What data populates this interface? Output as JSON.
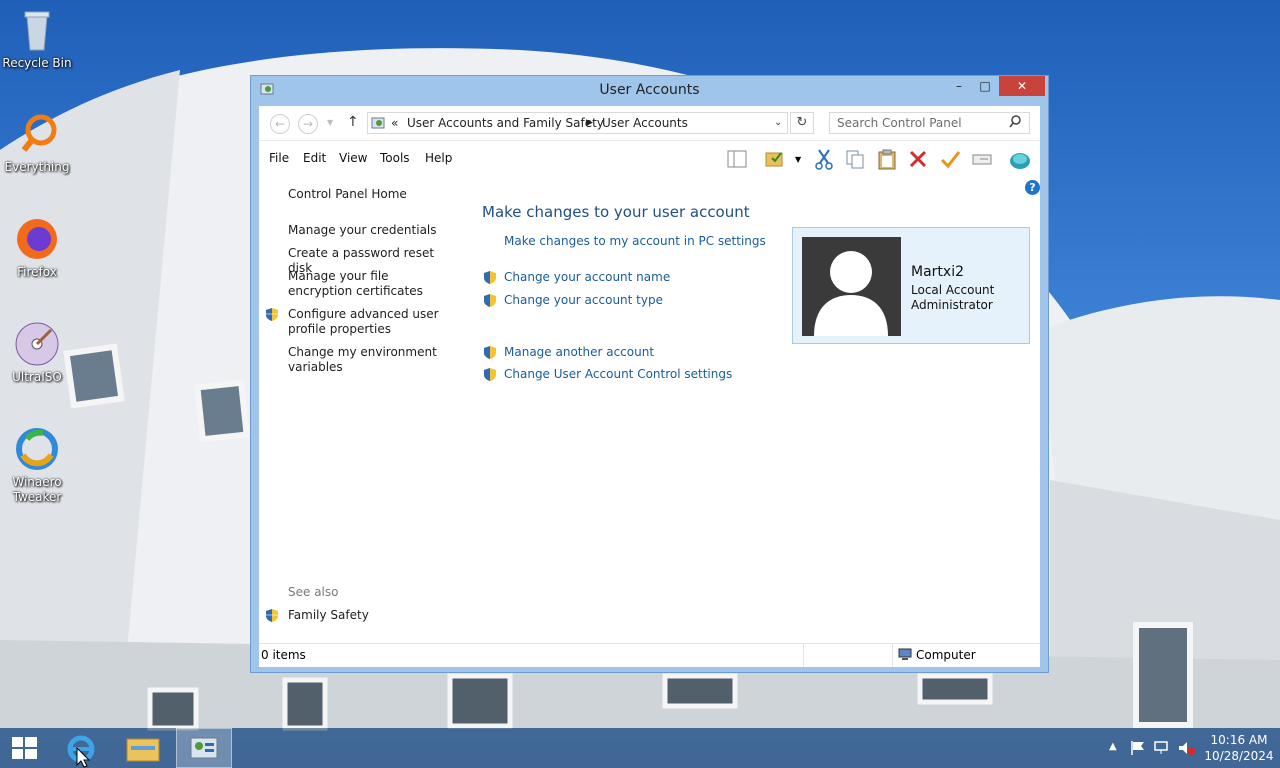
{
  "desktop_icons": [
    {
      "label": "Recycle Bin",
      "icon": "recycle-bin-icon"
    },
    {
      "label": "Everything",
      "icon": "everything-icon"
    },
    {
      "label": "Firefox",
      "icon": "firefox-icon"
    },
    {
      "label": "UltraISO",
      "icon": "ultraiso-icon"
    },
    {
      "label": "Winaero Tweaker",
      "icon": "winaero-tweaker-icon"
    }
  ],
  "window": {
    "title": "User Accounts",
    "controls": {
      "minimize": "–",
      "maximize": "□",
      "close": "✕"
    },
    "address": {
      "prefix": "«",
      "crumbs": [
        "User Accounts and Family Safety",
        "User Accounts"
      ]
    },
    "search": {
      "placeholder": "Search Control Panel"
    },
    "menu": [
      "File",
      "Edit",
      "View",
      "Tools",
      "Help"
    ],
    "left_pane": {
      "home": "Control Panel Home",
      "links": [
        "Manage your credentials",
        "Create a password reset disk",
        "Manage your file encryption certificates",
        "Configure advanced user profile properties",
        "Change my environment variables"
      ],
      "see_also": "See also",
      "family_safety": "Family Safety"
    },
    "main": {
      "heading": "Make changes to your user account",
      "pc_settings_link": "Make changes to my account in PC settings",
      "links": [
        "Change your account name",
        "Change your account type",
        "Manage another account",
        "Change User Account Control settings"
      ]
    },
    "user": {
      "name": "Martxi2",
      "account_type": "Local Account",
      "role": "Administrator"
    },
    "status": {
      "items": "0 items",
      "location": "Computer"
    }
  },
  "taskbar": {
    "time": "10:16 AM",
    "date": "10/28/2024"
  },
  "colors": {
    "link": "#1a5b9b",
    "heading": "#1f4f86",
    "close": "#c7433c",
    "window_frame": "#9fc6ea"
  }
}
